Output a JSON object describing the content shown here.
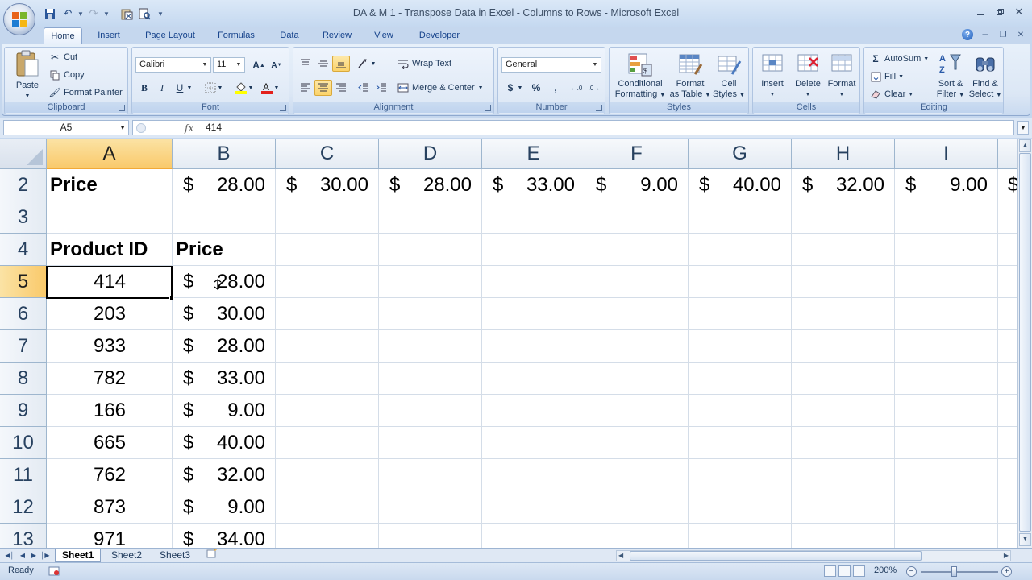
{
  "window": {
    "title": "DA & M 1 - Transpose Data in Excel - Columns to Rows - Microsoft Excel"
  },
  "ribbon": {
    "tabs": [
      "Home",
      "Insert",
      "Page Layout",
      "Formulas",
      "Data",
      "Review",
      "View",
      "Developer"
    ],
    "active_tab": "Home",
    "clipboard": {
      "label": "Clipboard",
      "paste": "Paste",
      "cut": "Cut",
      "copy": "Copy",
      "format_painter": "Format Painter"
    },
    "font": {
      "label": "Font",
      "name": "Calibri",
      "size": "11",
      "bold": "B",
      "italic": "I",
      "underline": "U"
    },
    "alignment": {
      "label": "Alignment",
      "wrap_text": "Wrap Text",
      "merge_center": "Merge & Center"
    },
    "number": {
      "label": "Number",
      "format": "General",
      "currency": "$",
      "percent": "%",
      "comma": ","
    },
    "styles": {
      "label": "Styles",
      "conditional": "Conditional",
      "conditional2": "Formatting",
      "format_table": "Format",
      "format_table2": "as Table",
      "cell_styles": "Cell",
      "cell_styles2": "Styles"
    },
    "cells": {
      "label": "Cells",
      "insert": "Insert",
      "delete": "Delete",
      "format": "Format"
    },
    "editing": {
      "label": "Editing",
      "autosum": "AutoSum",
      "fill": "Fill",
      "clear": "Clear",
      "sort_filter": "Sort &",
      "sort_filter2": "Filter",
      "find_select": "Find &",
      "find_select2": "Select"
    }
  },
  "formula_bar": {
    "name_box": "A5",
    "fx": "fx",
    "value": "414"
  },
  "columns": [
    "A",
    "B",
    "C",
    "D",
    "E",
    "F",
    "G",
    "H",
    "I"
  ],
  "selected_column": "A",
  "rows": [
    "2",
    "3",
    "4",
    "5",
    "6",
    "7",
    "8",
    "9",
    "10",
    "11",
    "12",
    "13"
  ],
  "selected_row": "5",
  "row2": {
    "label": "Price",
    "prices": [
      "28.00",
      "30.00",
      "28.00",
      "33.00",
      "9.00",
      "40.00",
      "32.00",
      "9.00"
    ]
  },
  "table": {
    "header_id": "Product ID",
    "header_price": "Price",
    "rows": [
      {
        "id": "414",
        "price": "28.00"
      },
      {
        "id": "203",
        "price": "30.00"
      },
      {
        "id": "933",
        "price": "28.00"
      },
      {
        "id": "782",
        "price": "33.00"
      },
      {
        "id": "166",
        "price": "9.00"
      },
      {
        "id": "665",
        "price": "40.00"
      },
      {
        "id": "762",
        "price": "32.00"
      },
      {
        "id": "873",
        "price": "9.00"
      },
      {
        "id": "971",
        "price": "34.00"
      }
    ]
  },
  "currency_symbol": "$",
  "sheets": [
    "Sheet1",
    "Sheet2",
    "Sheet3"
  ],
  "active_sheet": "Sheet1",
  "status": {
    "ready": "Ready",
    "zoom": "200%"
  }
}
